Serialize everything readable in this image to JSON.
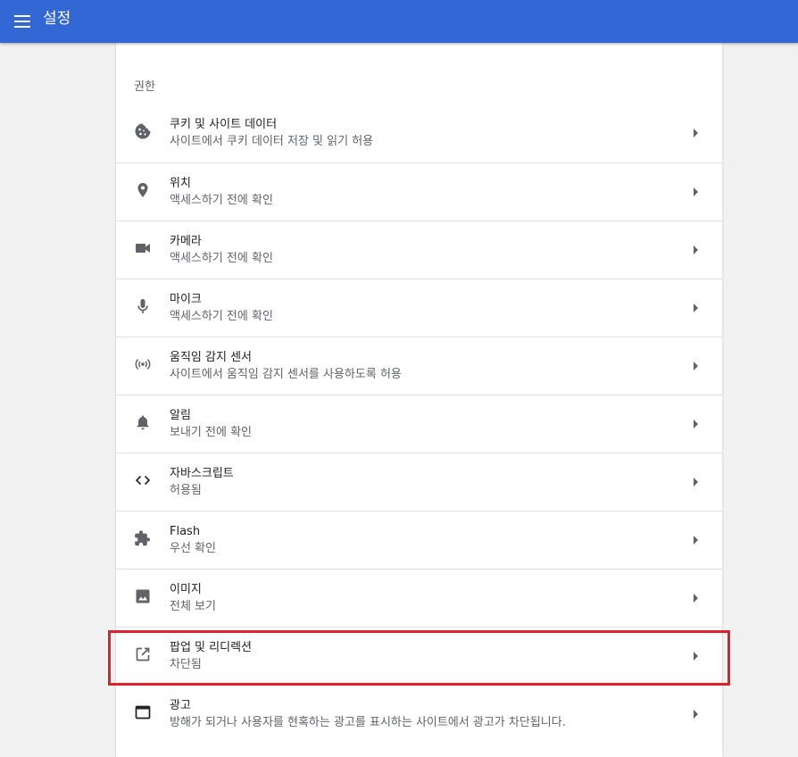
{
  "header": {
    "title": "설정",
    "menu_icon": "hamburger-menu-icon",
    "background_color": "#3367d6"
  },
  "section": {
    "title": "권한"
  },
  "rows": [
    {
      "name": "cookies",
      "icon": "cookie-icon",
      "label": "쿠키 및 사이트 데이터",
      "sub": "사이트에서 쿠키 데이터 저장 및 읽기 허용"
    },
    {
      "name": "location",
      "icon": "location-pin-icon",
      "label": "위치",
      "sub": "액세스하기 전에 확인"
    },
    {
      "name": "camera",
      "icon": "videocam-icon",
      "label": "카메라",
      "sub": "액세스하기 전에 확인"
    },
    {
      "name": "microphone",
      "icon": "mic-icon",
      "label": "마이크",
      "sub": "액세스하기 전에 확인"
    },
    {
      "name": "motion-sensors",
      "icon": "sensors-icon",
      "label": "움직임 감지 센서",
      "sub": "사이트에서 움직임 감지 센서를 사용하도록 허용"
    },
    {
      "name": "notifications",
      "icon": "bell-icon",
      "label": "알림",
      "sub": "보내기 전에 확인"
    },
    {
      "name": "javascript",
      "icon": "code-icon",
      "label": "자바스크립트",
      "sub": "허용됨"
    },
    {
      "name": "flash",
      "icon": "puzzle-icon",
      "label": "Flash",
      "sub": "우선 확인"
    },
    {
      "name": "images",
      "icon": "image-icon",
      "label": "이미지",
      "sub": "전체 보기"
    },
    {
      "name": "popups",
      "icon": "open-in-new-icon",
      "label": "팝업 및 리디렉션",
      "sub": "차단됨",
      "highlighted": true
    },
    {
      "name": "ads",
      "icon": "web-asset-icon",
      "label": "광고",
      "sub": "방해가 되거나 사용자를 현혹하는 광고를 표시하는 사이트에서 광고가 차단됩니다."
    }
  ],
  "highlight_color": "#e0202a"
}
